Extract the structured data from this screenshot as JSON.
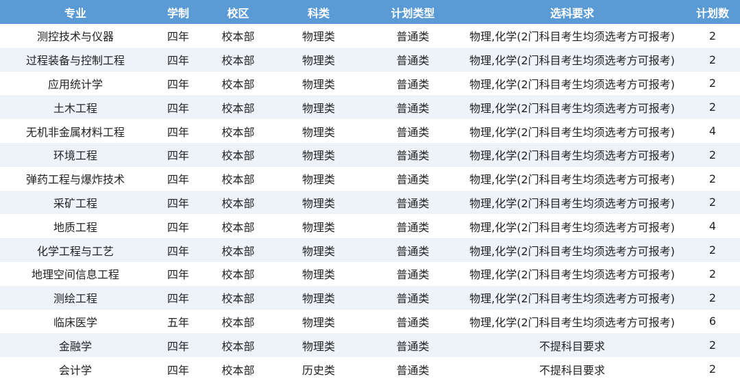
{
  "table": {
    "headers": [
      "专业",
      "学制",
      "校区",
      "科类",
      "计划类型",
      "选科要求",
      "计划数"
    ],
    "rows": [
      [
        "测控技术与仪器",
        "四年",
        "校本部",
        "物理类",
        "普通类",
        "物理,化学(2门科目考生均须选考方可报考)",
        "2"
      ],
      [
        "过程装备与控制工程",
        "四年",
        "校本部",
        "物理类",
        "普通类",
        "物理,化学(2门科目考生均须选考方可报考)",
        "2"
      ],
      [
        "应用统计学",
        "四年",
        "校本部",
        "物理类",
        "普通类",
        "物理,化学(2门科目考生均须选考方可报考)",
        "2"
      ],
      [
        "土木工程",
        "四年",
        "校本部",
        "物理类",
        "普通类",
        "物理,化学(2门科目考生均须选考方可报考)",
        "2"
      ],
      [
        "无机非金属材料工程",
        "四年",
        "校本部",
        "物理类",
        "普通类",
        "物理,化学(2门科目考生均须选考方可报考)",
        "4"
      ],
      [
        "环境工程",
        "四年",
        "校本部",
        "物理类",
        "普通类",
        "物理,化学(2门科目考生均须选考方可报考)",
        "2"
      ],
      [
        "弹药工程与爆炸技术",
        "四年",
        "校本部",
        "物理类",
        "普通类",
        "物理,化学(2门科目考生均须选考方可报考)",
        "2"
      ],
      [
        "采矿工程",
        "四年",
        "校本部",
        "物理类",
        "普通类",
        "物理,化学(2门科目考生均须选考方可报考)",
        "2"
      ],
      [
        "地质工程",
        "四年",
        "校本部",
        "物理类",
        "普通类",
        "物理,化学(2门科目考生均须选考方可报考)",
        "4"
      ],
      [
        "化学工程与工艺",
        "四年",
        "校本部",
        "物理类",
        "普通类",
        "物理,化学(2门科目考生均须选考方可报考)",
        "2"
      ],
      [
        "地理空间信息工程",
        "四年",
        "校本部",
        "物理类",
        "普通类",
        "物理,化学(2门科目考生均须选考方可报考)",
        "2"
      ],
      [
        "测绘工程",
        "四年",
        "校本部",
        "物理类",
        "普通类",
        "物理,化学(2门科目考生均须选考方可报考)",
        "2"
      ],
      [
        "临床医学",
        "五年",
        "校本部",
        "物理类",
        "普通类",
        "物理,化学(2门科目考生均须选考方可报考)",
        "6"
      ],
      [
        "金融学",
        "四年",
        "校本部",
        "物理类",
        "普通类",
        "不提科目要求",
        "2"
      ],
      [
        "会计学",
        "四年",
        "校本部",
        "历史类",
        "普通类",
        "不提科目要求",
        "2"
      ]
    ]
  },
  "colors": {
    "header_bg": "#5b9bd5",
    "header_text": "#ffffff",
    "row_alt_bg": "#eef3fa",
    "row_bg": "#ffffff",
    "text": "#222222"
  }
}
